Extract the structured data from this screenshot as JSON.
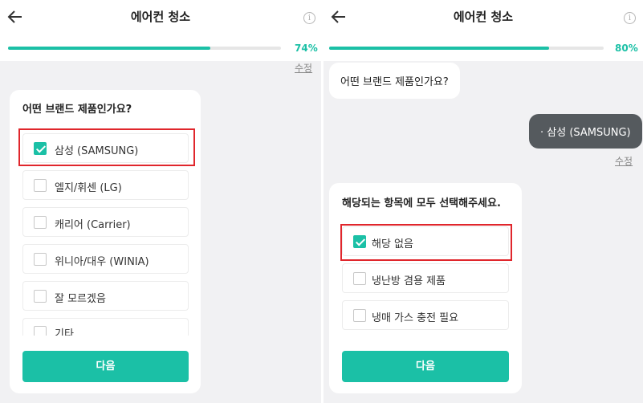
{
  "left": {
    "header": {
      "title": "에어컨 청소",
      "progress_label": "74%",
      "progress": 0.74
    },
    "edit_label": "수정",
    "question": "어떤 브랜드 제품인가요?",
    "options": [
      {
        "label": "삼성 (SAMSUNG)",
        "checked": true
      },
      {
        "label": "엘지/휘센 (LG)",
        "checked": false
      },
      {
        "label": "캐리어 (Carrier)",
        "checked": false
      },
      {
        "label": "위니아/대우 (WINIA)",
        "checked": false
      },
      {
        "label": "잘 모르겠음",
        "checked": false
      },
      {
        "label": "기타",
        "checked": false
      }
    ],
    "next_label": "다음"
  },
  "right": {
    "header": {
      "title": "에어컨 청소",
      "progress_label": "80%",
      "progress": 0.8
    },
    "bot_question": "어떤 브랜드 제품인가요?",
    "user_answer": "· 삼성 (SAMSUNG)",
    "edit_label": "수정",
    "question": "해당되는 항목에 모두 선택해주세요.",
    "options": [
      {
        "label": "해당 없음",
        "checked": true
      },
      {
        "label": "냉난방 겸용 제품",
        "checked": false
      },
      {
        "label": "냉매 가스 충전 필요",
        "checked": false
      }
    ],
    "next_label": "다음"
  },
  "colors": {
    "accent": "#1bc0a6",
    "highlight": "#e0262c",
    "user_bubble": "#555a5e"
  },
  "icons": {
    "back": "arrow-left-icon",
    "info": "info-icon",
    "check": "checkmark-icon"
  }
}
